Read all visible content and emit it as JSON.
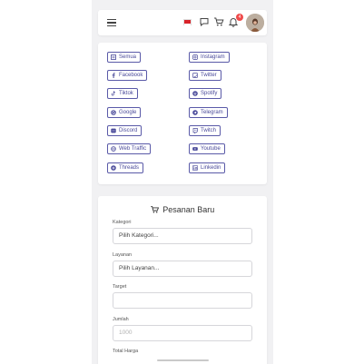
{
  "header": {
    "notification_count": "4",
    "accent_color": "#4a4a9a"
  },
  "categories": [
    {
      "label": "Semua",
      "icon": "list-icon"
    },
    {
      "label": "Instagram",
      "icon": "instagram-icon"
    },
    {
      "label": "Facebook",
      "icon": "facebook-icon"
    },
    {
      "label": "Twitter",
      "icon": "twitter-icon"
    },
    {
      "label": "Tiktok",
      "icon": "tiktok-icon"
    },
    {
      "label": "Spotify",
      "icon": "spotify-icon"
    },
    {
      "label": "Google",
      "icon": "google-icon"
    },
    {
      "label": "Telegram",
      "icon": "telegram-icon"
    },
    {
      "label": "Discord",
      "icon": "discord-icon"
    },
    {
      "label": "Twitch",
      "icon": "twitch-icon"
    },
    {
      "label": "Web Traffic",
      "icon": "globe-icon"
    },
    {
      "label": "Youtube",
      "icon": "youtube-icon"
    },
    {
      "label": "Threads",
      "icon": "threads-icon"
    },
    {
      "label": "Linkedin",
      "icon": "linkedin-icon"
    }
  ],
  "order": {
    "title": "Pesanan Baru",
    "kategori_label": "Kategori",
    "kategori_value": "Pilih Kategori...",
    "layanan_label": "Layanan",
    "layanan_value": "Pilih Layanan...",
    "target_label": "Target",
    "target_value": "",
    "jumlah_label": "Jumlah",
    "jumlah_placeholder": "1000",
    "total_label": "Total Harga"
  }
}
